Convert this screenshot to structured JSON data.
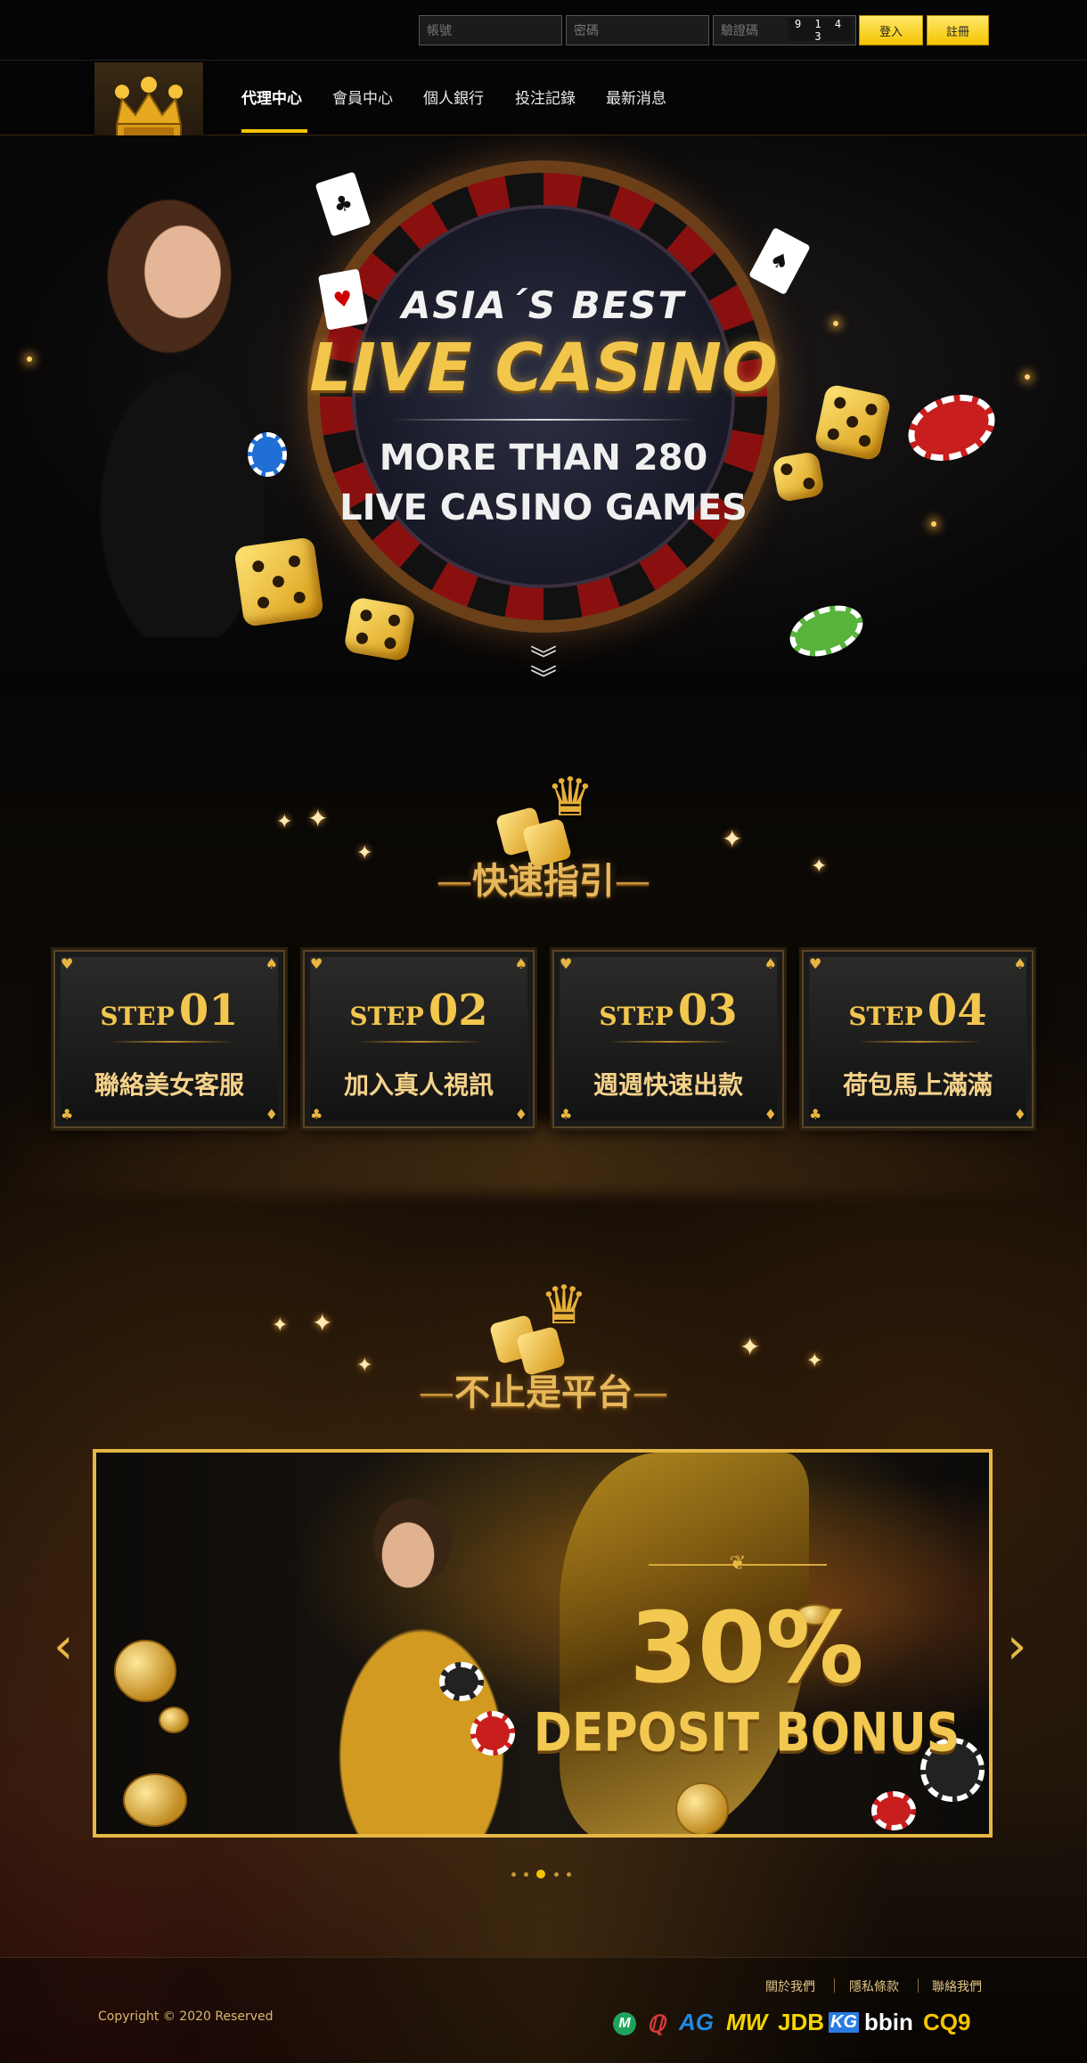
{
  "login": {
    "account_placeholder": "帳號",
    "password_placeholder": "密碼",
    "captcha_placeholder": "驗證碼",
    "captcha_code": "9 1 4 3",
    "login_label": "登入",
    "register_label": "註冊"
  },
  "nav": {
    "items": [
      {
        "label": "代理中心",
        "active": true
      },
      {
        "label": "會員中心"
      },
      {
        "label": "個人銀行"
      },
      {
        "label": "投注記錄"
      },
      {
        "label": "最新消息"
      }
    ]
  },
  "hero": {
    "line1": "ASIA´S BEST",
    "line2": "LIVE CASINO",
    "line3": "MORE THAN 280",
    "line4": "LIVE CASINO GAMES"
  },
  "guide": {
    "title": "快速指引",
    "steps": [
      {
        "word": "STEP",
        "num": "01",
        "text": "聯絡美女客服"
      },
      {
        "word": "STEP",
        "num": "02",
        "text": "加入真人視訊"
      },
      {
        "word": "STEP",
        "num": "03",
        "text": "週週快速出款"
      },
      {
        "word": "STEP",
        "num": "04",
        "text": "荷包馬上滿滿"
      }
    ]
  },
  "platform": {
    "title": "不止是平台",
    "banner": {
      "percent": "30%",
      "label": "DEPOSIT BONUS"
    },
    "carousel": {
      "count": 5,
      "active_index": 2
    }
  },
  "footer": {
    "links": [
      "關於我們",
      "隱私條款",
      "聯絡我們"
    ],
    "copyright": "Copyright © 2020 Reserved",
    "providers": [
      "AG",
      "MW",
      "JDB",
      "KG",
      "bbin",
      "CQ9"
    ]
  },
  "colors": {
    "gold": "#f5c400",
    "title_gold": "#e6b85a",
    "background": "#050505"
  }
}
